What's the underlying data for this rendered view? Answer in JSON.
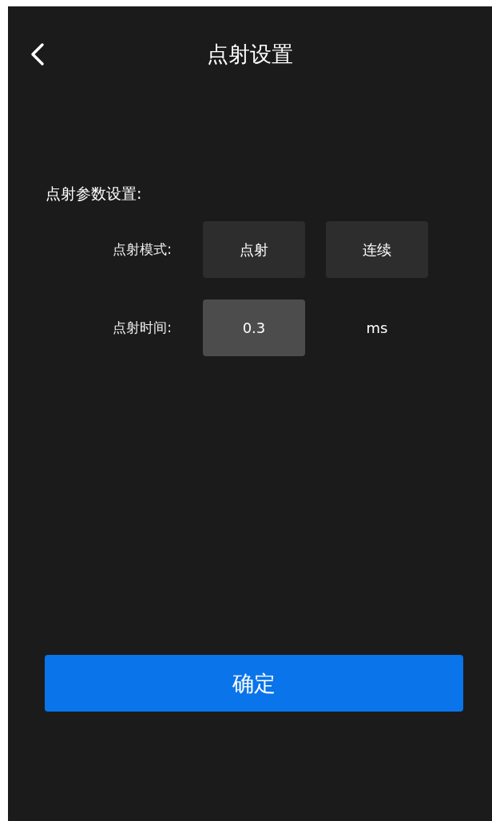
{
  "header": {
    "title": "点射设置"
  },
  "section": {
    "title": "点射参数设置:"
  },
  "mode_row": {
    "label": "点射模式:",
    "options": [
      {
        "label": "点射"
      },
      {
        "label": "连续"
      }
    ]
  },
  "time_row": {
    "label": "点射时间:",
    "value": "0.3",
    "unit": "ms"
  },
  "confirm_button": {
    "label": "确定"
  }
}
